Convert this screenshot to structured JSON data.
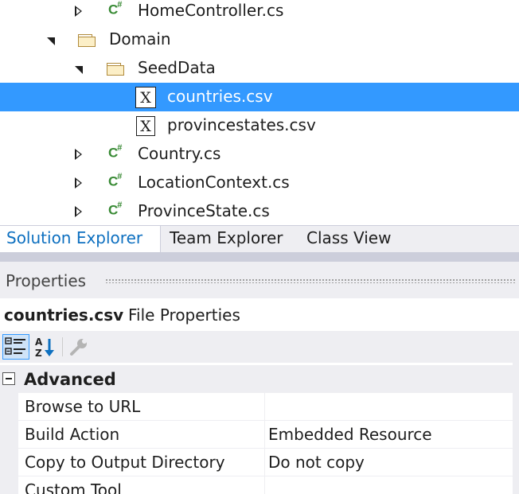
{
  "solution_explorer": {
    "items": [
      {
        "label": "HomeController.cs",
        "icon": "csharp-file-icon",
        "expander": "collapsed",
        "selected": false
      },
      {
        "label": "Domain",
        "icon": "folder-icon",
        "expander": "expanded",
        "selected": false
      },
      {
        "label": "SeedData",
        "icon": "folder-icon",
        "expander": "expanded",
        "selected": false
      },
      {
        "label": "countries.csv",
        "icon": "excel-file-icon",
        "expander": "none",
        "selected": true
      },
      {
        "label": "provincestates.csv",
        "icon": "excel-file-icon",
        "expander": "none",
        "selected": false
      },
      {
        "label": "Country.cs",
        "icon": "csharp-file-icon",
        "expander": "collapsed",
        "selected": false
      },
      {
        "label": "LocationContext.cs",
        "icon": "csharp-file-icon",
        "expander": "collapsed",
        "selected": false
      },
      {
        "label": "ProvinceState.cs",
        "icon": "csharp-file-icon",
        "expander": "collapsed",
        "selected": false
      }
    ]
  },
  "tabs": [
    {
      "label": "Solution Explorer",
      "active": true
    },
    {
      "label": "Team Explorer",
      "active": false
    },
    {
      "label": "Class View",
      "active": false
    }
  ],
  "properties": {
    "title": "Properties",
    "object_name": "countries.csv",
    "object_type": "File Properties",
    "toolbar": {
      "categorized_icon": "categorized-icon",
      "alphabetical_icon": "alphabetical-sort-icon",
      "property_pages_icon": "wrench-icon"
    },
    "category": "Advanced",
    "rows": [
      {
        "name": "Browse to URL",
        "value": ""
      },
      {
        "name": "Build Action",
        "value": "Embedded Resource"
      },
      {
        "name": "Copy to Output Directory",
        "value": "Do not copy"
      },
      {
        "name": "Custom Tool",
        "value": ""
      }
    ]
  },
  "colors": {
    "selection": "#3399ff",
    "csharp_icon": "#388a34",
    "active_tab_text": "#0e70c0",
    "chrome": "#eeeef2"
  }
}
